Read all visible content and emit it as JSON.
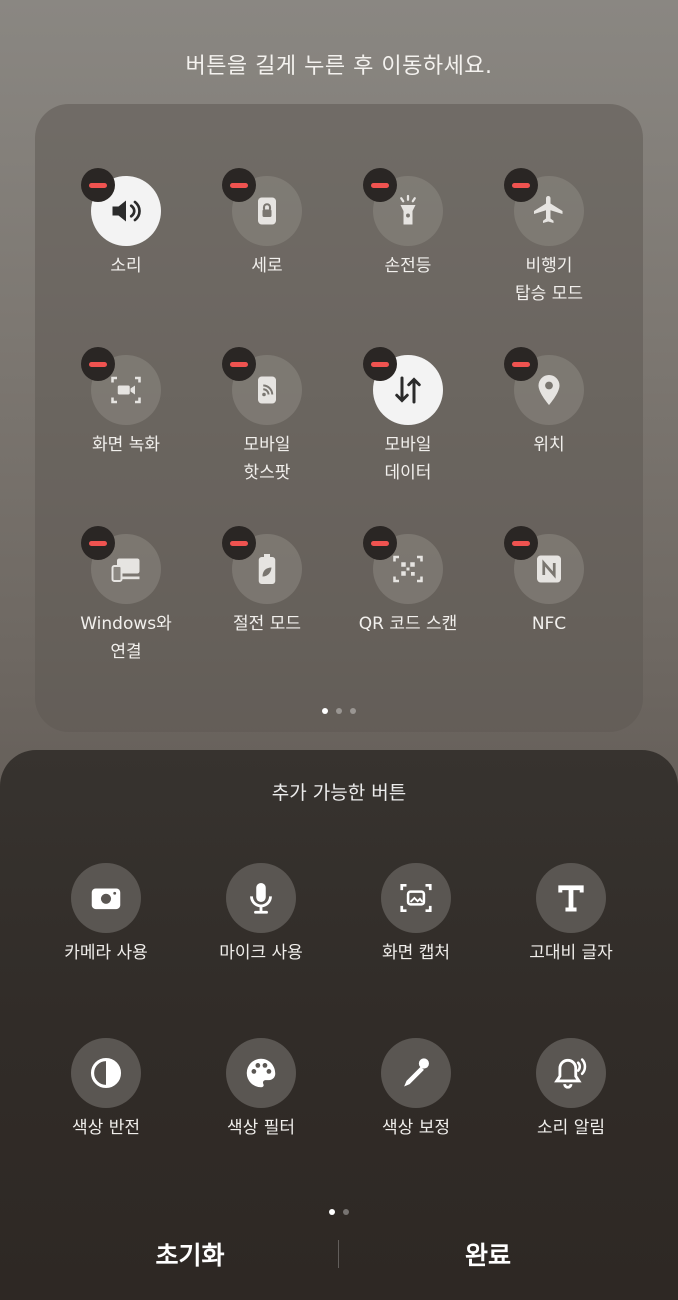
{
  "instruction": "버튼을 길게 누른 후 이동하세요.",
  "active_buttons": [
    {
      "label": "소리",
      "icon": "volume-icon",
      "on": true
    },
    {
      "label": "세로",
      "icon": "portrait-lock-icon",
      "on": false
    },
    {
      "label": "손전등",
      "icon": "flashlight-icon",
      "on": false
    },
    {
      "label": "비행기\n탑승 모드",
      "icon": "airplane-icon",
      "on": false
    },
    {
      "label": "화면 녹화",
      "icon": "screen-record-icon",
      "on": false
    },
    {
      "label": "모바일\n핫스팟",
      "icon": "hotspot-icon",
      "on": false
    },
    {
      "label": "모바일\n데이터",
      "icon": "mobile-data-icon",
      "on": true
    },
    {
      "label": "위치",
      "icon": "location-icon",
      "on": false
    },
    {
      "label": "Windows와\n연결",
      "icon": "link-to-windows-icon",
      "on": false
    },
    {
      "label": "절전 모드",
      "icon": "power-saving-icon",
      "on": false
    },
    {
      "label": "QR 코드 스캔",
      "icon": "qr-scan-icon",
      "on": false
    },
    {
      "label": "NFC",
      "icon": "nfc-icon",
      "on": false
    }
  ],
  "active_pages": {
    "count": 3,
    "current": 0
  },
  "available_title": "추가 가능한 버튼",
  "available_buttons": [
    {
      "label": "카메라 사용",
      "icon": "camera-icon"
    },
    {
      "label": "마이크 사용",
      "icon": "microphone-icon"
    },
    {
      "label": "화면 캡처",
      "icon": "screen-capture-icon"
    },
    {
      "label": "고대비 글자",
      "icon": "high-contrast-font-icon"
    },
    {
      "label": "색상 반전",
      "icon": "color-inversion-icon"
    },
    {
      "label": "색상 필터",
      "icon": "color-filter-icon"
    },
    {
      "label": "색상 보정",
      "icon": "color-correction-icon"
    },
    {
      "label": "소리 알림",
      "icon": "sound-notification-icon"
    }
  ],
  "available_pages": {
    "count": 2,
    "current": 0
  },
  "footer": {
    "reset_label": "초기화",
    "done_label": "완료"
  },
  "colors": {
    "remove_badge": "#ef5350",
    "active_tile": "#f3f3f3"
  }
}
